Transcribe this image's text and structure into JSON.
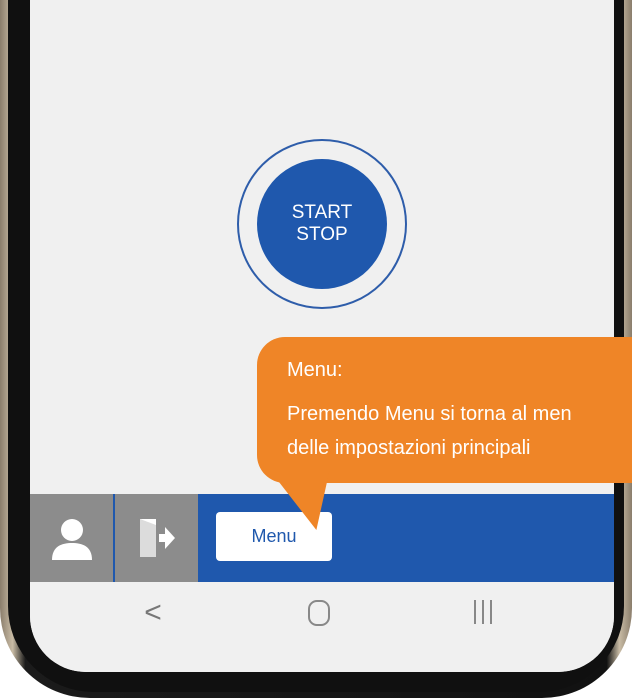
{
  "control": {
    "start_line1": "START",
    "start_line2": "STOP"
  },
  "bottom_bar": {
    "user_icon": "user-icon",
    "logout_icon": "logout-icon",
    "menu_label": "Menu"
  },
  "tooltip": {
    "title": "Menu:",
    "line1": "Premendo Menu si torna al men",
    "line2": "delle impostazioni principali"
  },
  "nav": {
    "back_glyph": "<",
    "home_icon": "home-icon",
    "recents_icon": "recents-icon"
  },
  "colors": {
    "accent_blue": "#1f58ad",
    "tooltip_orange": "#ef8527",
    "tile_gray": "#8c8c8c",
    "screen_bg": "#f0f0f0"
  }
}
